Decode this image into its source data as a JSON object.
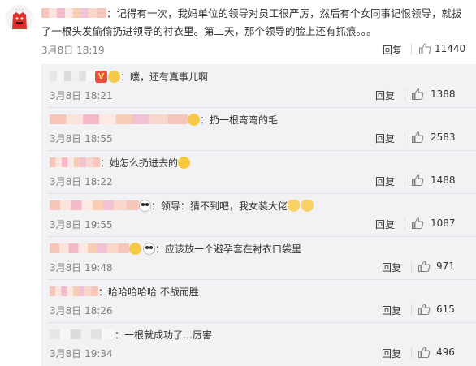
{
  "main_comment": {
    "text": "：记得有一次，我妈单位的领导对员工很严厉，然后有个女同事记恨领导，就拔了一根头发偷偷扔进领导的衬衣里。第二天，那个领导的脸上还有抓痕。。。",
    "time": "3月8日 18:19",
    "reply_label": "回复",
    "likes": "11440"
  },
  "sub_comments": [
    {
      "text": "：噗，还有真事儿啊",
      "time": "3月8日 18:21",
      "reply_label": "回复",
      "likes": "1388"
    },
    {
      "text": "：扔一根弯弯的毛",
      "time": "3月8日 18:55",
      "reply_label": "回复",
      "likes": "2583"
    },
    {
      "text": "：她怎么扔进去的",
      "time": "3月8日 18:22",
      "reply_label": "回复",
      "likes": "1488"
    },
    {
      "text": "：领导：猜不到吧，我女装大佬",
      "time": "3月8日 19:55",
      "reply_label": "回复",
      "likes": "1087"
    },
    {
      "text": "：应该放一个避孕套在衬衣口袋里",
      "time": "3月8日 19:48",
      "reply_label": "回复",
      "likes": "971"
    },
    {
      "text": "：哈哈哈哈哈 不战而胜",
      "time": "3月8日 18:26",
      "reply_label": "回复",
      "likes": "615"
    },
    {
      "text": "：一根就成功了…厉害",
      "time": "3月8日 19:34",
      "reply_label": "回复",
      "likes": "496"
    }
  ],
  "icons": {
    "like": "thumbs-up-icon",
    "avatar": "red-cartoon-avatar"
  },
  "colors": {
    "accent": "#eb7350",
    "sub_bg": "#f2f2f5",
    "meta": "#808080"
  }
}
